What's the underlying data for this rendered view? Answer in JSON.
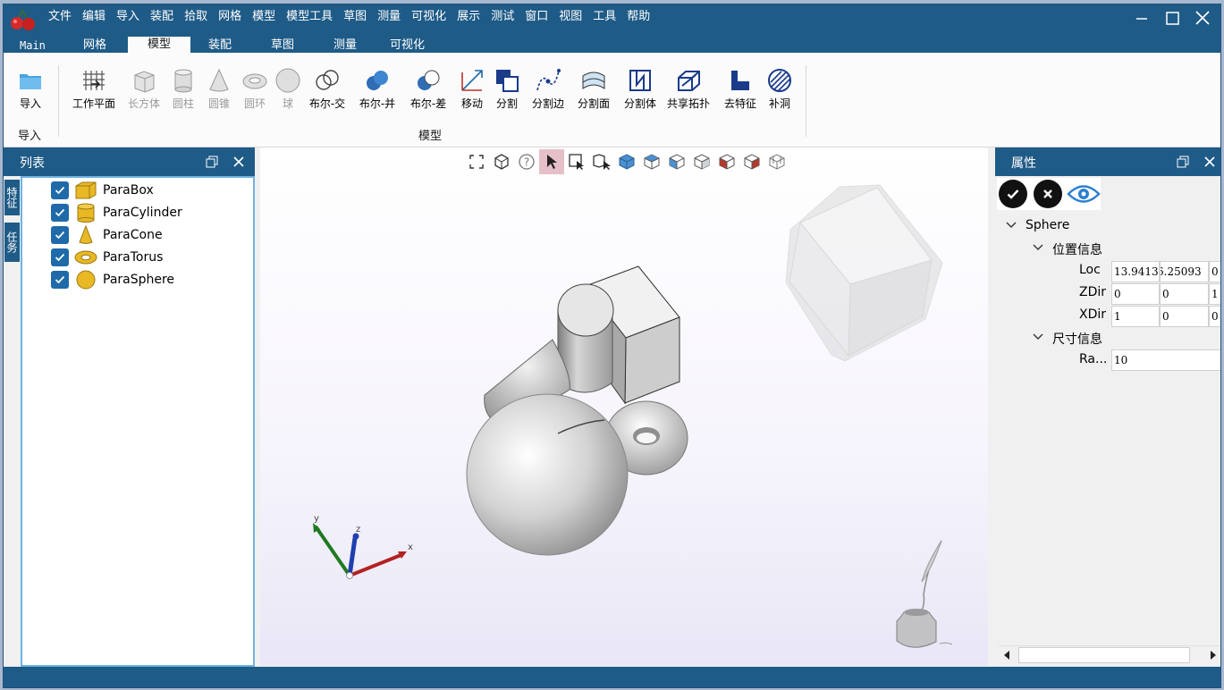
{
  "menu": [
    "文件",
    "编辑",
    "导入",
    "装配",
    "拾取",
    "网格",
    "模型",
    "模型工具",
    "草图",
    "测量",
    "可视化",
    "展示",
    "测试",
    "窗口",
    "视图",
    "工具",
    "帮助"
  ],
  "tabs": [
    "Main",
    "网格",
    "模型",
    "装配",
    "草图",
    "测量",
    "可视化"
  ],
  "active_tab": "模型",
  "ribbon": {
    "import_label": "导入",
    "import_group": "导入",
    "model_group": "模型",
    "buttons": [
      "工作平面",
      "长方体",
      "圆柱",
      "圆锥",
      "圆环",
      "球",
      "布尔-交",
      "布尔-并",
      "布尔-差",
      "移动",
      "分割",
      "分割边",
      "分割面",
      "分割体",
      "共享拓扑",
      "去特征",
      "补洞"
    ]
  },
  "list_panel": {
    "title": "列表",
    "side_tabs": [
      "特征",
      "任务"
    ],
    "items": [
      {
        "name": "ParaBox",
        "checked": true
      },
      {
        "name": "ParaCylinder",
        "checked": true
      },
      {
        "name": "ParaCone",
        "checked": true
      },
      {
        "name": "ParaTorus",
        "checked": true
      },
      {
        "name": "ParaSphere",
        "checked": true
      }
    ]
  },
  "properties": {
    "title": "属性",
    "object": "Sphere",
    "position_group": "位置信息",
    "rows": [
      {
        "label": "Loc",
        "values": [
          "13.9413",
          "6.25093",
          "0"
        ]
      },
      {
        "label": "ZDir",
        "values": [
          "0",
          "0",
          "1"
        ]
      },
      {
        "label": "XDir",
        "values": [
          "1",
          "0",
          "0"
        ]
      }
    ],
    "size_group": "尺寸信息",
    "size_label": "Ra...",
    "size_value": "10"
  },
  "axes": {
    "x": "x",
    "y": "y",
    "z": "z"
  },
  "colors": {
    "primary": "#1f5b87",
    "accent": "#1f6aa8",
    "viewport_top": "#ffffff",
    "viewport_bottom": "#e9e7f6",
    "x_axis": "#b22222",
    "y_axis": "#1f7a1f",
    "z_axis": "#1f3fb0"
  }
}
